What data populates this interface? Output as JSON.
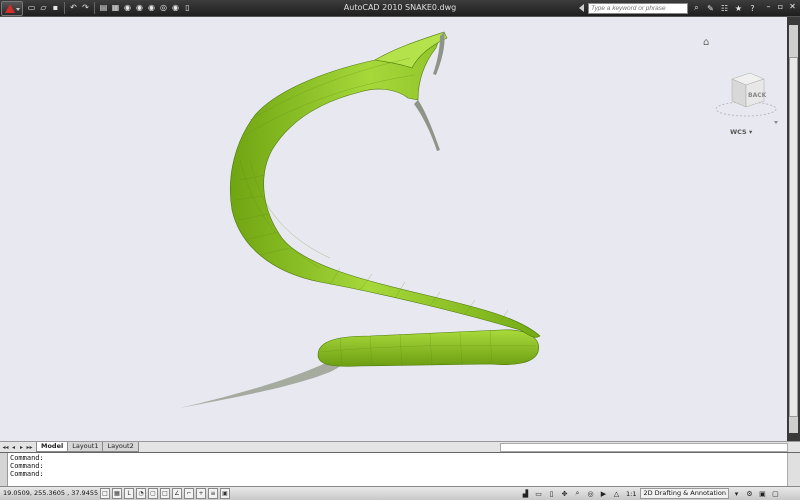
{
  "window": {
    "title": "AutoCAD 2010    SNAKE0.dwg"
  },
  "quick_access": [
    {
      "name": "new-icon",
      "glyph": "▭"
    },
    {
      "name": "open-icon",
      "glyph": "▱"
    },
    {
      "name": "save-icon",
      "glyph": "▪"
    },
    {
      "name": "undo-icon",
      "glyph": "↶"
    },
    {
      "name": "redo-icon",
      "glyph": "↷"
    },
    {
      "name": "plot-icon",
      "glyph": "▤"
    },
    {
      "name": "publish-icon",
      "glyph": "▦"
    },
    {
      "name": "tool-icon-1",
      "glyph": "◉"
    },
    {
      "name": "tool-icon-2",
      "glyph": "◉"
    },
    {
      "name": "tool-icon-3",
      "glyph": "◉"
    },
    {
      "name": "tool-icon-4",
      "glyph": "◎"
    },
    {
      "name": "tool-icon-5",
      "glyph": "◉"
    },
    {
      "name": "tool-icon-6",
      "glyph": "▯"
    }
  ],
  "search": {
    "placeholder": "Type a keyword or phrase"
  },
  "title_tools": [
    {
      "name": "search-icon",
      "glyph": "⌕"
    },
    {
      "name": "tools-icon",
      "glyph": "✎"
    },
    {
      "name": "comm-center-icon",
      "glyph": "☷"
    },
    {
      "name": "favorites-icon",
      "glyph": "★"
    },
    {
      "name": "help-icon",
      "glyph": "?"
    }
  ],
  "window_controls": [
    {
      "name": "minimize-button",
      "glyph": "–"
    },
    {
      "name": "restore-button",
      "glyph": "▫"
    },
    {
      "name": "close-button",
      "glyph": "✕"
    }
  ],
  "viewcube": {
    "face": "BACK",
    "coords": "WCS"
  },
  "layout_tabs": [
    {
      "label": "Model",
      "active": true
    },
    {
      "label": "Layout1",
      "active": false
    },
    {
      "label": "Layout2",
      "active": false
    }
  ],
  "tab_nav": [
    "◂◂",
    "◂",
    "▸",
    "▸▸"
  ],
  "command_lines": [
    "Command:",
    "Command:",
    "Command:",
    "",
    "Command:"
  ],
  "status": {
    "coordinates": "19.0509,  255.3605 , 37.9455",
    "annotation_scale": "1:1",
    "workspace": "2D Drafting & Annotation"
  },
  "status_toggles": [
    {
      "name": "snap-mode-toggle",
      "glyph": "□"
    },
    {
      "name": "grid-display-toggle",
      "glyph": "▦"
    },
    {
      "name": "ortho-mode-toggle",
      "glyph": "L"
    },
    {
      "name": "polar-tracking-toggle",
      "glyph": "◔"
    },
    {
      "name": "object-snap-toggle",
      "glyph": "▢"
    },
    {
      "name": "3d-osnap-toggle",
      "glyph": "□"
    },
    {
      "name": "object-snap-tracking-toggle",
      "glyph": "∠"
    },
    {
      "name": "dynamic-ucs-toggle",
      "glyph": "⌐"
    },
    {
      "name": "dynamic-input-toggle",
      "glyph": "+"
    },
    {
      "name": "lineweight-toggle",
      "glyph": "≡"
    },
    {
      "name": "quick-properties-toggle",
      "glyph": "▣"
    }
  ],
  "status_tools": [
    {
      "name": "model-space-icon",
      "glyph": "▟"
    },
    {
      "name": "quick-view-layouts-icon",
      "glyph": "▭"
    },
    {
      "name": "quick-view-drawings-icon",
      "glyph": "▯"
    },
    {
      "name": "pan-icon",
      "glyph": "✥"
    },
    {
      "name": "zoom-icon",
      "glyph": "⌕"
    },
    {
      "name": "steering-wheel-icon",
      "glyph": "◎"
    },
    {
      "name": "showmotion-icon",
      "glyph": "▶"
    },
    {
      "name": "annotation-scale-icon",
      "glyph": "△"
    }
  ],
  "status_end_tools": [
    {
      "name": "workspace-icon",
      "glyph": "⚙"
    },
    {
      "name": "lock-icon",
      "glyph": "▣"
    },
    {
      "name": "clean-screen-icon",
      "glyph": "▢"
    }
  ],
  "colors": {
    "model_body": "#8fc81e",
    "model_shade": "#5f8f10",
    "model_light": "#b8e050",
    "canvas_bg": "#e8e8f0"
  }
}
